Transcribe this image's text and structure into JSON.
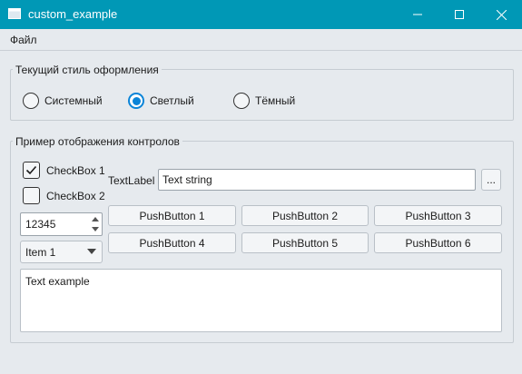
{
  "window": {
    "title": "custom_example",
    "app_icon": "window-app-icon",
    "accent": "#0098b6"
  },
  "menubar": {
    "items": [
      {
        "label": "Файл"
      }
    ]
  },
  "style_group": {
    "title": "Текущий стиль оформления",
    "options": [
      {
        "label": "Системный",
        "checked": false
      },
      {
        "label": "Светлый",
        "checked": true
      },
      {
        "label": "Тёмный",
        "checked": false
      }
    ]
  },
  "controls_group": {
    "title": "Пример отображения контролов",
    "checkboxes": [
      {
        "label": "CheckBox 1",
        "checked": true
      },
      {
        "label": "CheckBox 2",
        "checked": false
      }
    ],
    "text_label": "TextLabel",
    "line_edit_value": "Text string",
    "browse_button": "...",
    "spinbox_value": "12345",
    "combo_value": "Item 1",
    "push_buttons": [
      "PushButton 1",
      "PushButton 2",
      "PushButton 3",
      "PushButton 4",
      "PushButton 5",
      "PushButton 6"
    ],
    "text_edit_value": "Text example"
  },
  "colors": {
    "radio_checked": "#0a84d8",
    "background": "#e6eaee"
  }
}
